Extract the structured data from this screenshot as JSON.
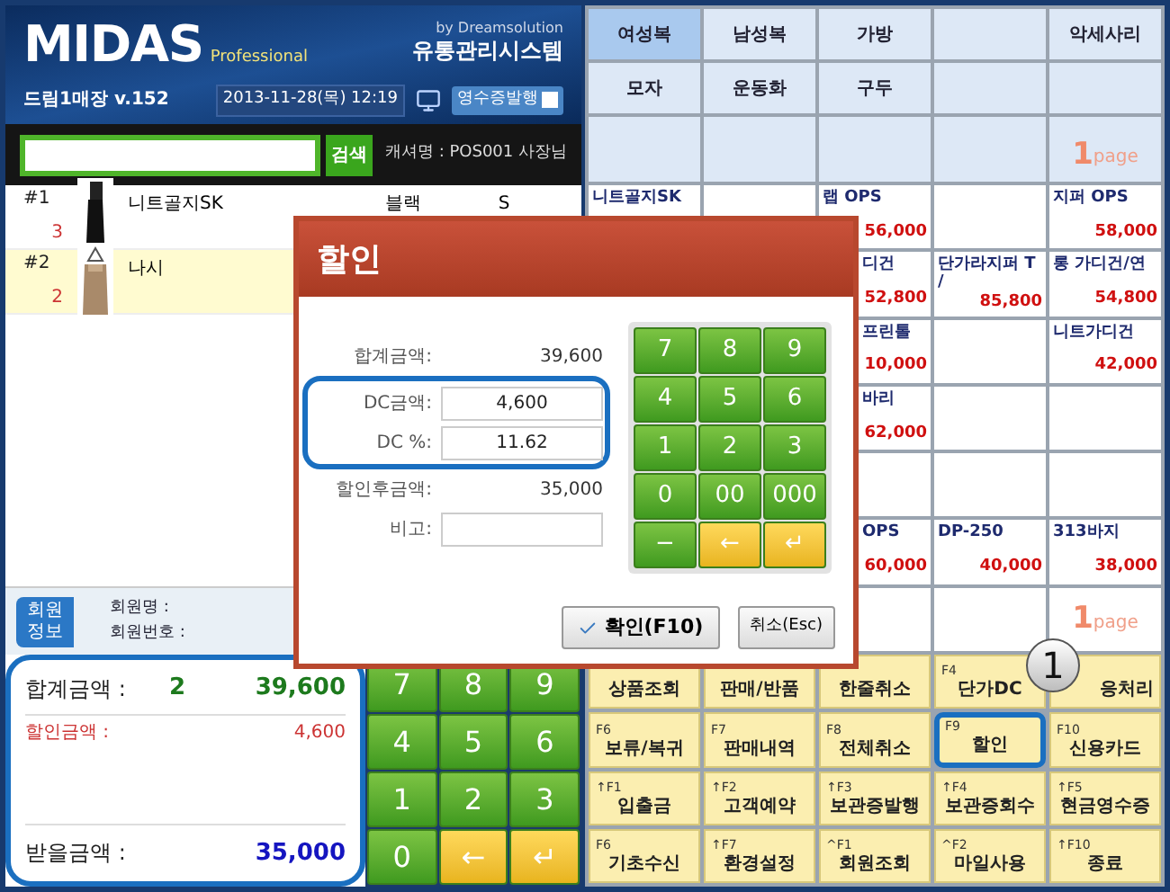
{
  "header": {
    "logo": "MIDAS",
    "edition": "Professional",
    "vendor": "by Dreamsolution",
    "system": "유통관리시스템",
    "store": "드림1매장 v.152",
    "datetime": "2013-11-28(목) 12:19",
    "receipt_button": {
      "label": "영수증발행",
      "checked": false
    }
  },
  "search": {
    "button": "검색",
    "cashier": "캐셔명 : POS001 사장님"
  },
  "items": [
    {
      "no": "#1",
      "qty": "3",
      "name": "니트골지SK",
      "color_label": "블랙",
      "size": "S",
      "selected": false
    },
    {
      "no": "#2",
      "qty": "2",
      "name": "나시",
      "selected": true
    }
  ],
  "member": {
    "badge": "회원 정보",
    "labels": [
      "회원명 :",
      "회원번호 :"
    ]
  },
  "totals": {
    "highlighted": true,
    "rows": [
      {
        "kind": "total",
        "label": "합계금액 :",
        "count": "2",
        "amount": "39,600"
      },
      {
        "kind": "discount",
        "label": "할인금액 :",
        "amount": "4,600"
      },
      {
        "kind": "due",
        "label": "받을금액 :",
        "amount": "35,000"
      }
    ]
  },
  "keypad": [
    {
      "label": "7",
      "kind": "digit"
    },
    {
      "label": "8",
      "kind": "digit"
    },
    {
      "label": "9",
      "kind": "digit"
    },
    {
      "label": "4",
      "kind": "digit"
    },
    {
      "label": "5",
      "kind": "digit"
    },
    {
      "label": "6",
      "kind": "digit"
    },
    {
      "label": "1",
      "kind": "digit"
    },
    {
      "label": "2",
      "kind": "digit"
    },
    {
      "label": "3",
      "kind": "digit"
    },
    {
      "label": "0",
      "kind": "digit"
    },
    {
      "label": "←",
      "kind": "action"
    },
    {
      "label": "↵",
      "kind": "action"
    }
  ],
  "categories": [
    {
      "kind": "button",
      "label": "여성복",
      "selected": true
    },
    {
      "kind": "button",
      "label": "남성복",
      "selected": false
    },
    {
      "kind": "button",
      "label": "가방",
      "selected": false
    },
    {
      "kind": "empty"
    },
    {
      "kind": "button",
      "label": "악세사리",
      "selected": false
    },
    {
      "kind": "button",
      "label": "모자",
      "selected": false
    },
    {
      "kind": "button",
      "label": "운동화",
      "selected": false
    },
    {
      "kind": "button",
      "label": "구두",
      "selected": false
    },
    {
      "kind": "empty"
    },
    {
      "kind": "empty"
    },
    {
      "kind": "empty"
    },
    {
      "kind": "empty"
    },
    {
      "kind": "empty"
    },
    {
      "kind": "empty"
    },
    {
      "kind": "page",
      "page": "1",
      "unit": "page"
    }
  ],
  "products": [
    {
      "kind": "product",
      "name": "니트골지SK"
    },
    {
      "kind": "empty"
    },
    {
      "kind": "product",
      "name": "랩 OPS",
      "price": "56,000"
    },
    {
      "kind": "empty"
    },
    {
      "kind": "product",
      "name": "지퍼 OPS",
      "price": "58,000"
    },
    {
      "kind": "product",
      "name": "디건",
      "price": "52,800"
    },
    {
      "kind": "product",
      "name": "단가라지퍼 T /",
      "price": "85,800"
    },
    {
      "kind": "product",
      "name": "롱 가디건/연",
      "price": "54,800"
    },
    {
      "kind": "product",
      "name": "프린톨",
      "price": "10,000"
    },
    {
      "kind": "empty"
    },
    {
      "kind": "product",
      "name": "니트가디건",
      "price": "42,000"
    },
    {
      "kind": "product",
      "name": "바리",
      "price": "62,000"
    },
    {
      "kind": "empty"
    },
    {
      "kind": "empty"
    },
    {
      "kind": "empty"
    },
    {
      "kind": "empty"
    },
    {
      "kind": "empty"
    },
    {
      "kind": "product",
      "name": "OPS",
      "price": "60,000"
    },
    {
      "kind": "product",
      "name": "DP-250",
      "price": "40,000"
    },
    {
      "kind": "product",
      "name": "313바지",
      "price": "38,000"
    },
    {
      "kind": "empty"
    },
    {
      "kind": "empty"
    },
    {
      "kind": "page",
      "page": "1",
      "unit": "page"
    }
  ],
  "functions": [
    {
      "label": "상품조회",
      "highlighted": false
    },
    {
      "label": "판매/반품",
      "highlighted": false
    },
    {
      "label": "한줄취소",
      "highlighted": false
    },
    {
      "key": "F4",
      "label": "단가DC",
      "highlighted": false
    },
    {
      "label": "응처리",
      "highlighted": false
    },
    {
      "key": "F6",
      "label": "보류/복귀",
      "highlighted": false
    },
    {
      "key": "F7",
      "label": "판매내역",
      "highlighted": false
    },
    {
      "key": "F8",
      "label": "전체취소",
      "highlighted": false
    },
    {
      "key": "F9",
      "label": "할인",
      "highlighted": true
    },
    {
      "key": "F10",
      "label": "신용카드",
      "highlighted": false
    },
    {
      "key": "↑F1",
      "label": "입출금",
      "highlighted": false
    },
    {
      "key": "↑F2",
      "label": "고객예약",
      "highlighted": false
    },
    {
      "key": "↑F3",
      "label": "보관증발행",
      "highlighted": false
    },
    {
      "key": "↑F4",
      "label": "보관증회수",
      "highlighted": false
    },
    {
      "key": "↑F5",
      "label": "현금영수증",
      "highlighted": false
    },
    {
      "key": "F6",
      "label": "기초수신",
      "highlighted": false
    },
    {
      "key": "↑F7",
      "label": "환경설정",
      "highlighted": false
    },
    {
      "key": "^F1",
      "label": "회원조회",
      "highlighted": false
    },
    {
      "key": "^F2",
      "label": "마일사용",
      "highlighted": false
    },
    {
      "key": "↑F10",
      "label": "종료",
      "highlighted": false
    }
  ],
  "callout": "1",
  "dialog": {
    "title": "할인",
    "fields": [
      {
        "kind": "value",
        "label": "합계금액:",
        "value": "39,600",
        "highlighted": false
      },
      {
        "kind": "input",
        "label": "DC금액:",
        "value": "4,600",
        "highlighted": true
      },
      {
        "kind": "input",
        "label": "DC %:",
        "value": "11.62",
        "highlighted": true
      },
      {
        "kind": "value",
        "label": "할인후금액:",
        "value": "35,000",
        "highlighted": false
      },
      {
        "kind": "input",
        "label": "비고:",
        "highlighted": false
      }
    ],
    "keypad": [
      {
        "label": "7",
        "kind": "digit"
      },
      {
        "label": "8",
        "kind": "digit"
      },
      {
        "label": "9",
        "kind": "digit"
      },
      {
        "label": "4",
        "kind": "digit"
      },
      {
        "label": "5",
        "kind": "digit"
      },
      {
        "label": "6",
        "kind": "digit"
      },
      {
        "label": "1",
        "kind": "digit"
      },
      {
        "label": "2",
        "kind": "digit"
      },
      {
        "label": "3",
        "kind": "digit"
      },
      {
        "label": "0",
        "kind": "digit"
      },
      {
        "label": "00",
        "kind": "digit"
      },
      {
        "label": "000",
        "kind": "digit"
      },
      {
        "label": "−",
        "kind": "digit"
      },
      {
        "label": "←",
        "kind": "action"
      },
      {
        "label": "↵",
        "kind": "action"
      }
    ],
    "ok": "확인(F10)",
    "cancel": "취소(Esc)"
  }
}
